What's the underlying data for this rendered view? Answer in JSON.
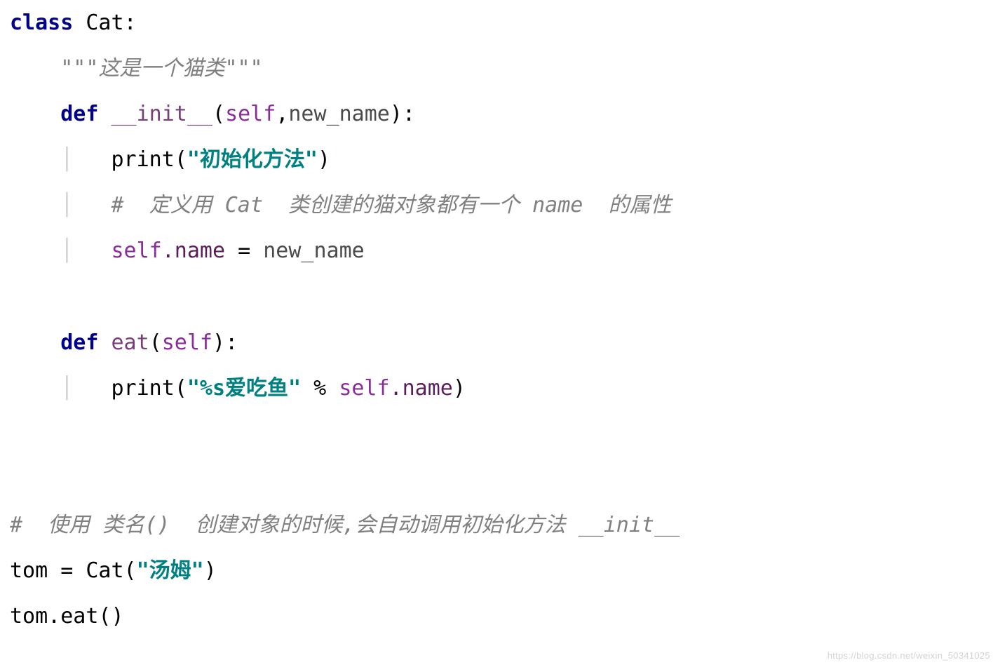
{
  "code": {
    "kw_class": "class",
    "cls_name": "Cat",
    "colon": ":",
    "docstring_open": "\"\"\"",
    "docstring_text": "这是一个猫类",
    "docstring_close": "\"\"\"",
    "kw_def": "def",
    "fn_init": "__init__",
    "self": "self",
    "param_new_name": "new_name",
    "print_call": "print",
    "str_init": "\"初始化方法\"",
    "comment_attr": "#  定义用 Cat  类创建的猫对象都有一个 name  的属性",
    "attr_name": ".name",
    "assign": " = ",
    "fn_eat": "eat",
    "str_eat": "\"%s爱吃鱼\"",
    "pct": " % ",
    "comment_main": "#  使用 类名()  创建对象的时候,会自动调用初始化方法 __init__",
    "tom": "tom",
    "tom_assign": " = Cat(",
    "str_tom": "\"汤姆\"",
    "close_paren": ")",
    "tom_eat": "tom.eat()"
  },
  "watermark": "https://blog.csdn.net/weixin_50341025"
}
